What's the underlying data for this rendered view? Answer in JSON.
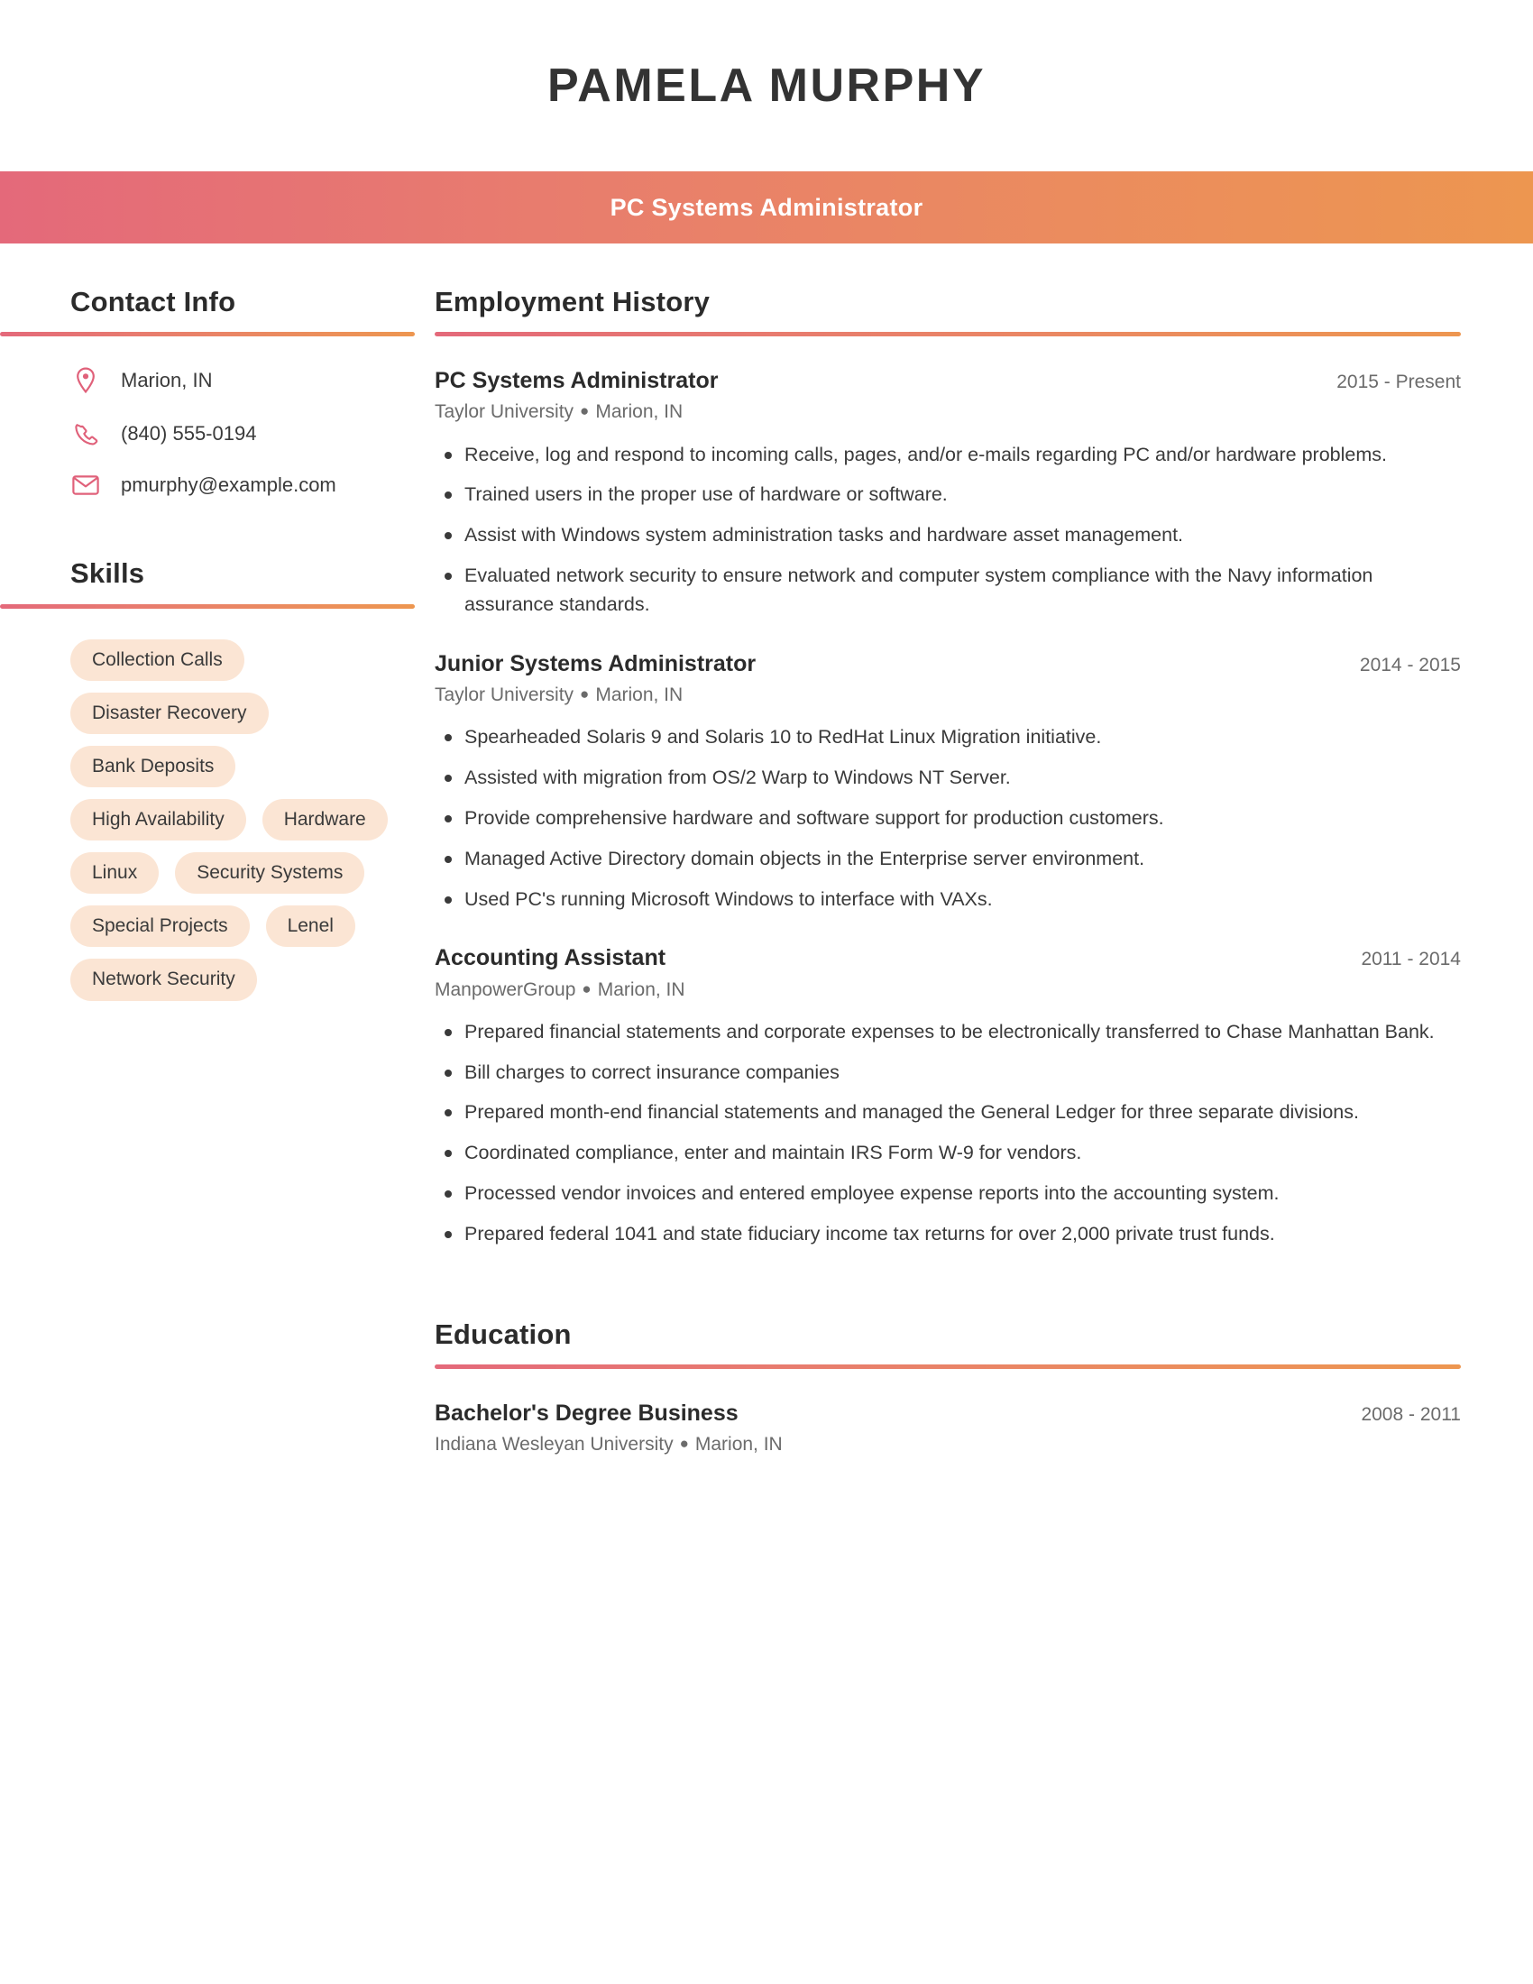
{
  "header": {
    "full_name": "PAMELA MURPHY",
    "job_title": "PC Systems Administrator",
    "accent_start": "#E4697A",
    "accent_end": "#ED9650"
  },
  "sidebar": {
    "contact": {
      "heading": "Contact Info",
      "items": [
        {
          "icon": "location-pin-icon",
          "value": "Marion, IN"
        },
        {
          "icon": "phone-icon",
          "value": "(840) 555-0194"
        },
        {
          "icon": "envelope-icon",
          "value": "pmurphy@example.com"
        }
      ]
    },
    "skills": {
      "heading": "Skills",
      "pill_bg": "#FBE5D4",
      "items": [
        "Collection Calls",
        "Disaster Recovery",
        "Bank Deposits",
        "High Availability",
        "Hardware",
        "Linux",
        "Security Systems",
        "Special Projects",
        "Lenel",
        "Network Security"
      ]
    }
  },
  "main": {
    "employment": {
      "heading": "Employment History",
      "entries": [
        {
          "title": "PC Systems Administrator",
          "dates": "2015 - Present",
          "company": "Taylor University",
          "location": "Marion, IN",
          "bullets": [
            "Receive, log and respond to incoming calls, pages, and/or e-mails regarding PC and/or hardware problems.",
            "Trained users in the proper use of hardware or software.",
            "Assist with Windows system administration tasks and hardware asset management.",
            "Evaluated network security to ensure network and computer system compliance with the Navy information assurance standards."
          ]
        },
        {
          "title": "Junior Systems Administrator",
          "dates": "2014 - 2015",
          "company": "Taylor University",
          "location": "Marion, IN",
          "bullets": [
            "Spearheaded Solaris 9 and Solaris 10 to RedHat Linux Migration initiative.",
            "Assisted with migration from OS/2 Warp to Windows NT Server.",
            "Provide comprehensive hardware and software support for production customers.",
            "Managed Active Directory domain objects in the Enterprise server environment.",
            "Used PC's running Microsoft Windows to interface with VAXs."
          ]
        },
        {
          "title": "Accounting Assistant",
          "dates": "2011 - 2014",
          "company": "ManpowerGroup",
          "location": "Marion, IN",
          "bullets": [
            "Prepared financial statements and corporate expenses to be electronically transferred to Chase Manhattan Bank.",
            "Bill charges to correct insurance companies",
            "Prepared month-end financial statements and managed the General Ledger for three separate divisions.",
            "Coordinated compliance, enter and maintain IRS Form W-9 for vendors.",
            "Processed vendor invoices and entered employee expense reports into the accounting system.",
            "Prepared federal 1041 and state fiduciary income tax returns for over 2,000 private trust funds."
          ]
        }
      ]
    },
    "education": {
      "heading": "Education",
      "entries": [
        {
          "title": "Bachelor's Degree Business",
          "dates": "2008 - 2011",
          "school": "Indiana Wesleyan University",
          "location": "Marion, IN"
        }
      ]
    }
  }
}
